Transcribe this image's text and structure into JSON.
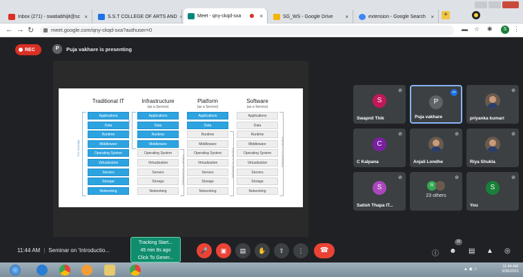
{
  "browser": {
    "tabs": [
      {
        "label": "Inbox (271) - swatiabhijit@sc",
        "fav_color": "#d93025",
        "active": false
      },
      {
        "label": "S.S.T COLLEGE OF ARTS AND",
        "fav_color": "#1a73e8",
        "active": false
      },
      {
        "label": "Meet - qny-ckqd-sxa",
        "fav_color": "#00897b",
        "active": true
      },
      {
        "label": "SG_WS - Google Drive",
        "fav_color": "#f4b400",
        "active": false
      },
      {
        "label": "extension - Google Search",
        "fav_color": "#4285f4",
        "active": false
      }
    ],
    "tab_close": "×",
    "new_tab": "+",
    "url": "meet.google.com/qny-ckqd-sxa?authuser=0",
    "ext_avatar": "S"
  },
  "meet": {
    "rec_label": "REC",
    "presenter_avatar": "P",
    "presenting_text": "Puja vakhare is presenting",
    "slide": {
      "columns": [
        {
          "title": "Traditional IT",
          "subtitle": "",
          "blue_count": 9
        },
        {
          "title": "Infrastructure",
          "subtitle": "(as a Service)",
          "blue_count": 4
        },
        {
          "title": "Platform",
          "subtitle": "(as a Service)",
          "blue_count": 2
        },
        {
          "title": "Software",
          "subtitle": "(as a Service)",
          "blue_count": 0
        }
      ],
      "layers": [
        "Applications",
        "Data",
        "Runtime",
        "Middleware",
        "Operating System",
        "Virtualization",
        "Servers",
        "Storage",
        "Networking"
      ],
      "you_manage": "You manage",
      "delivered": "Delivered as a service"
    },
    "participants": [
      {
        "name": "Swapnil Thik",
        "initial": "S",
        "color": "#c2185b",
        "muted": true
      },
      {
        "name": "Puja vakhare",
        "initial": "P",
        "color": "#5f6368",
        "muted": false,
        "speaking": true
      },
      {
        "name": "priyanka kumari",
        "initial": "",
        "color": "",
        "muted": true,
        "photo": true
      },
      {
        "name": "C Kalpana",
        "initial": "C",
        "color": "#7b1fa2",
        "muted": true
      },
      {
        "name": "Anjali Londhe",
        "initial": "",
        "color": "",
        "muted": true,
        "photo": true
      },
      {
        "name": "Riya Shukla",
        "initial": "",
        "color": "",
        "muted": true,
        "photo": true
      },
      {
        "name": "Satish Thapa IT...",
        "initial": "S",
        "color": "#ab47bc",
        "muted": true
      },
      {
        "name": "23 others",
        "initial": "R",
        "color": "#34a853",
        "muted": true,
        "others": true
      },
      {
        "name": "You",
        "initial": "S",
        "color": "#188038",
        "muted": true
      }
    ],
    "time": "11:44 AM",
    "meeting_title": "Seminar on 'Introductio...",
    "tracking": {
      "line1": "Tracking Start...",
      "line2": "45 min 8s ago",
      "line3": "Click To Gener..."
    },
    "participant_count": "32"
  },
  "taskbar": {
    "time": "11:44 AM",
    "date": "9/30/2021"
  }
}
